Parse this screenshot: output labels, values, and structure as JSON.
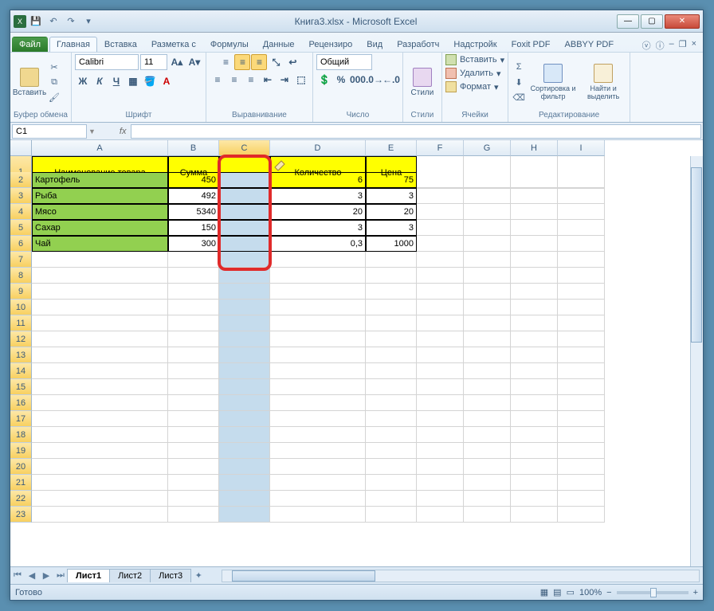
{
  "title": "Книга3.xlsx - Microsoft Excel",
  "qat": {
    "save": "💾",
    "undo": "↶",
    "redo": "↷"
  },
  "tabs": {
    "file": "Файл",
    "items": [
      "Главная",
      "Вставка",
      "Разметка с",
      "Формулы",
      "Данные",
      "Рецензиро",
      "Вид",
      "Разработч",
      "Надстройк",
      "Foxit PDF",
      "ABBYY PDF"
    ],
    "active": 0
  },
  "ribbon": {
    "clipboard": {
      "label": "Буфер обмена",
      "paste": "Вставить"
    },
    "font": {
      "label": "Шрифт",
      "name": "Calibri",
      "size": "11"
    },
    "align": {
      "label": "Выравнивание"
    },
    "number": {
      "label": "Число",
      "format": "Общий"
    },
    "styles": {
      "label": "Стили",
      "btn": "Стили"
    },
    "cells": {
      "label": "Ячейки",
      "insert": "Вставить",
      "delete": "Удалить",
      "format": "Формат"
    },
    "editing": {
      "label": "Редактирование",
      "sort": "Сортировка и фильтр",
      "find": "Найти и выделить"
    }
  },
  "namebox": "C1",
  "formula": "",
  "columns": [
    "A",
    "B",
    "C",
    "D",
    "E",
    "F",
    "G",
    "H",
    "I"
  ],
  "selectedCol": "C",
  "headerRow": {
    "A": "Наименование товара",
    "B": "Сумма",
    "C": "",
    "D": "Количество",
    "E": "Цена"
  },
  "rows": [
    {
      "n": 2,
      "A": "Картофель",
      "B": "450",
      "D": "6",
      "E": "75"
    },
    {
      "n": 3,
      "A": "Рыба",
      "B": "492",
      "D": "3",
      "E": "3"
    },
    {
      "n": 4,
      "A": "Мясо",
      "B": "5340",
      "D": "20",
      "E": "20"
    },
    {
      "n": 5,
      "A": "Сахар",
      "B": "150",
      "D": "3",
      "E": "3"
    },
    {
      "n": 6,
      "A": "Чай",
      "B": "300",
      "D": "0,3",
      "E": "1000"
    }
  ],
  "maxRow": 23,
  "sheets": {
    "items": [
      "Лист1",
      "Лист2",
      "Лист3"
    ],
    "active": 0
  },
  "status": {
    "ready": "Готово",
    "zoom": "100%"
  }
}
